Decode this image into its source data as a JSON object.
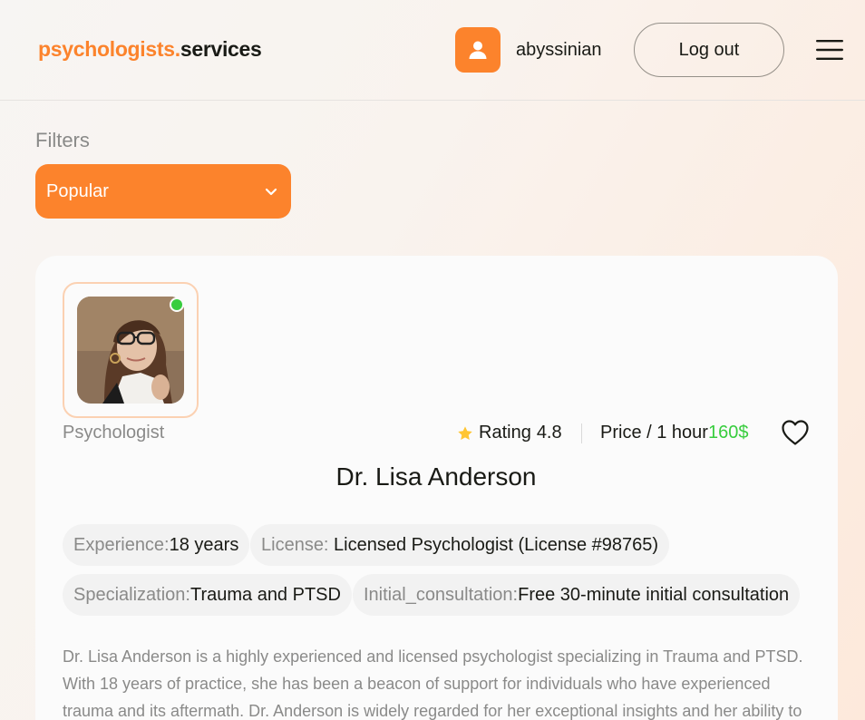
{
  "header": {
    "logo_brand": "psychologists.",
    "logo_tld": "services",
    "username": "abyssinian",
    "logout_label": "Log out",
    "icons": [
      "user-icon",
      "menu-icon"
    ],
    "accent_color": "#fc832c"
  },
  "filters": {
    "label": "Filters",
    "selected": "Popular"
  },
  "psychologist": {
    "profession": "Psychologist",
    "online": true,
    "rating_label": "Rating",
    "rating_value": "4.8",
    "price_label": "Price / 1 hour",
    "price_value": "160$",
    "name": "Dr. Lisa Anderson",
    "chips": [
      {
        "key": "Experience:",
        "value": "18 years"
      },
      {
        "key": "License:",
        "value": " Licensed Psychologist (License #98765)"
      },
      {
        "key": "Specialization:",
        "value": "Trauma and PTSD"
      },
      {
        "key": "Initial_consultation:",
        "value": "Free 30-minute initial consultation"
      }
    ],
    "description": "Dr. Lisa Anderson is a highly experienced and licensed psychologist specializing in Trauma and PTSD. With 18 years of practice, she has been a beacon of support for individuals who have experienced trauma and its aftermath. Dr. Anderson is widely regarded for her exceptional insights and her ability to bring"
  },
  "colors": {
    "accent": "#fc832c",
    "online": "#38cd3e",
    "price": "#38cd3e",
    "star": "#ffc531"
  }
}
